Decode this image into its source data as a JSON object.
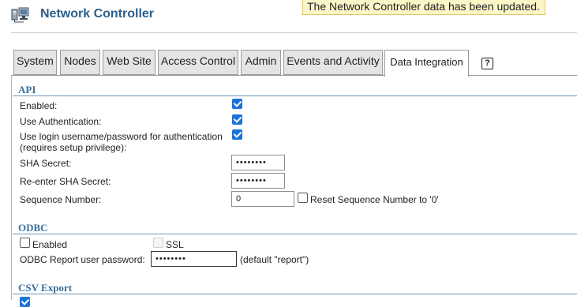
{
  "header": {
    "app_title": "Network Controller",
    "toast": "The Network Controller data has been updated."
  },
  "tabs": [
    {
      "label": "System",
      "active": false
    },
    {
      "label": "Nodes",
      "active": false
    },
    {
      "label": "Web Site",
      "active": false
    },
    {
      "label": "Access Control",
      "active": false
    },
    {
      "label": "Admin",
      "active": false
    },
    {
      "label": "Events and Activity",
      "active": false
    },
    {
      "label": "Data Integration",
      "active": true
    }
  ],
  "help_glyph": "?",
  "api": {
    "title": "API",
    "enabled_label": "Enabled:",
    "enabled": true,
    "use_auth_label": "Use Authentication:",
    "use_auth": true,
    "use_login_label_line1": "Use login username/password for authentication",
    "use_login_label_line2": "(requires setup privilege):",
    "use_login": true,
    "sha_secret_label": "SHA Secret:",
    "sha_secret_value": "••••••••",
    "reenter_label": "Re-enter SHA Secret:",
    "reenter_value": "••••••••",
    "sequence_label": "Sequence Number:",
    "sequence_value": "0",
    "reset_label": "Reset Sequence Number to '0'",
    "reset_checked": false
  },
  "odbc": {
    "title": "ODBC",
    "enabled_label": "Enabled",
    "enabled": false,
    "ssl_label": "SSL",
    "ssl": false,
    "password_label": "ODBC Report user password:",
    "password_value": "••••••••",
    "password_hint": "(default \"report\")"
  },
  "csv": {
    "title": "CSV Export"
  },
  "colors": {
    "title_blue": "#2c5f8a",
    "section_blue": "#3a6d99",
    "checkbox_blue": "#1a73d9",
    "toast_bg": "#fbf6c8"
  }
}
